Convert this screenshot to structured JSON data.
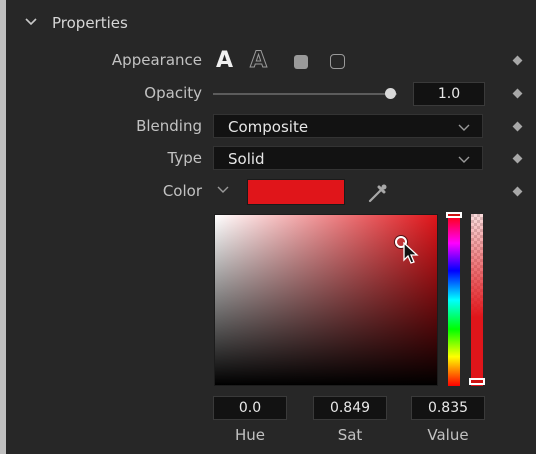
{
  "section": {
    "title": "Properties"
  },
  "rows": {
    "appearance": {
      "label": "Appearance",
      "icons": [
        "text-solid-icon",
        "text-outline-icon",
        "rounded-box-solid-icon",
        "rounded-box-outline-icon"
      ],
      "solid_glyph": "A",
      "outline_glyph": "A"
    },
    "opacity": {
      "label": "Opacity",
      "value": "1.0",
      "fraction": 1.0
    },
    "blending": {
      "label": "Blending",
      "selected": "Composite"
    },
    "type": {
      "label": "Type",
      "selected": "Solid"
    },
    "color": {
      "label": "Color",
      "swatch_hex": "#e0151a"
    }
  },
  "color_picker": {
    "hue": {
      "value": "0.0",
      "label": "Hue"
    },
    "sat": {
      "value": "0.849",
      "label": "Sat"
    },
    "val": {
      "value": "0.835",
      "label": "Value"
    }
  },
  "colors": {
    "panel_bg": "#272727",
    "accent_red": "#e0151a"
  }
}
